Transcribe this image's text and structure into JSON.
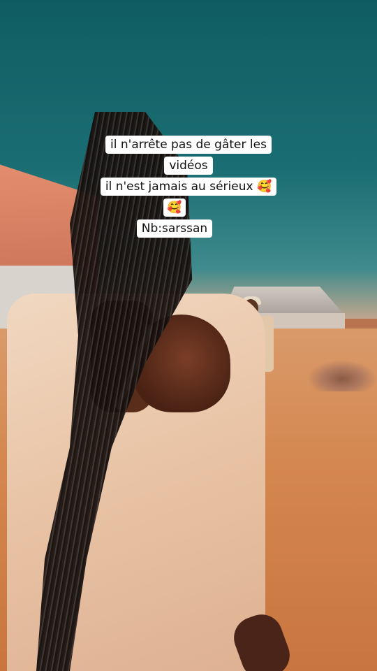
{
  "caption": {
    "lines": [
      "il n'arrête pas de gâter les",
      "vidéos",
      "il n'est jamais au sérieux 🥰",
      "🥰",
      "Nb:sarssan"
    ]
  },
  "colors": {
    "sky_top": "#0f5d63",
    "ground": "#d4874f",
    "caption_bg": "#ffffff",
    "caption_text": "#111111"
  }
}
